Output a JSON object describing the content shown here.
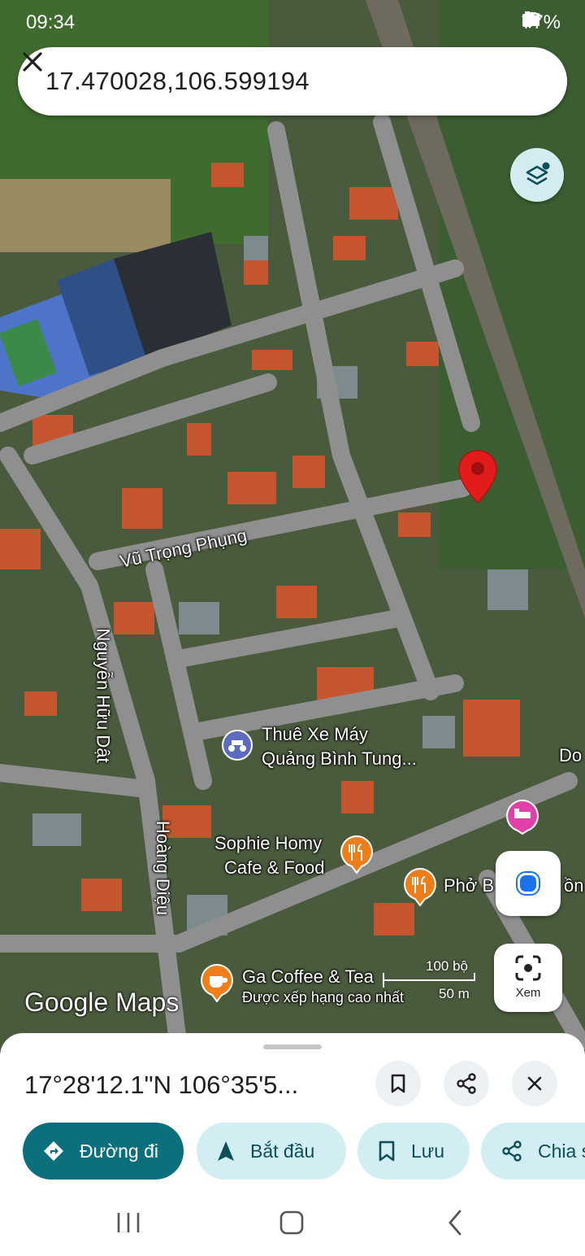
{
  "status_bar": {
    "time": "09:34",
    "battery": "77%"
  },
  "search": {
    "query": "17.470028,106.599194"
  },
  "map_labels": {
    "street_vu_trong_phung": "Vũ Trọng Phụng",
    "street_nguyen_huu_dat": "Nguyễn Hữu Dật",
    "street_hoang_dieu": "Hoàng Diệu",
    "poi_thue_xe_line1": "Thuê Xe Máy",
    "poi_thue_xe_line2": "Quảng Bình Tung...",
    "poi_sophie_line1": "Sophie Homy",
    "poi_sophie_line2": "Cafe & Food",
    "poi_pho": "Phở B",
    "poi_pho_tail": "ồn",
    "poi_ga_coffee": "Ga Coffee & Tea",
    "poi_ga_coffee_sub": "Được xếp hạng cao nhất",
    "edge_label": "Do"
  },
  "scale": {
    "imperial": "100 bộ",
    "metric": "50 m"
  },
  "logo_text": "Google Maps",
  "xem_label": "Xem",
  "sheet": {
    "coordinates": "17°28'12.1\"N 106°35'5..."
  },
  "actions": {
    "directions": "Đường đi",
    "start": "Bắt đầu",
    "save": "Lưu",
    "share": "Chia s"
  },
  "colors": {
    "primary": "#0b6f7d",
    "secondary": "#d2eef2",
    "pin": "#e21b1b",
    "location": "#1a73e8"
  },
  "icons": [
    "close-icon",
    "layers-icon",
    "pin-icon",
    "motorbike-icon",
    "restaurant-icon",
    "coffee-icon",
    "hotel-icon",
    "lens-icon",
    "bookmark-icon",
    "share-icon",
    "directions-icon",
    "navigation-icon"
  ]
}
